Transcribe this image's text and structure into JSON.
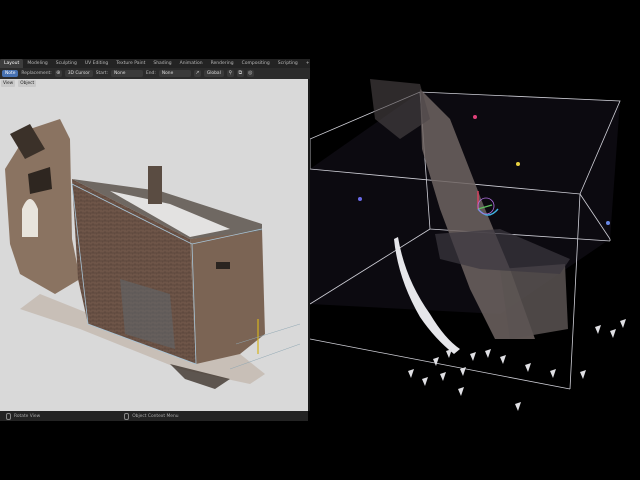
{
  "workspace_tabs": [
    {
      "label": "Layout",
      "active": true
    },
    {
      "label": "Modeling"
    },
    {
      "label": "Sculpting"
    },
    {
      "label": "UV Editing"
    },
    {
      "label": "Texture Paint"
    },
    {
      "label": "Shading"
    },
    {
      "label": "Animation"
    },
    {
      "label": "Rendering"
    },
    {
      "label": "Compositing"
    },
    {
      "label": "Scripting"
    },
    {
      "label": "+"
    }
  ],
  "toolbar": {
    "mode": "Note",
    "replacement_label": "Replacement:",
    "cursor": "3D Cursor",
    "start_label": "Start:",
    "start_value": "None",
    "end_label": "End:",
    "end_value": "None",
    "orientation": "Global"
  },
  "viewport_left": {
    "object_menu": [
      "View",
      "Object"
    ]
  },
  "statusbar": {
    "left": "Rotate View",
    "right": "Object Context Menu"
  },
  "colors": {
    "accent": "#4772b3",
    "viewport_bg": "#d9d9d9",
    "bbox_line": "#d0d0d8"
  }
}
